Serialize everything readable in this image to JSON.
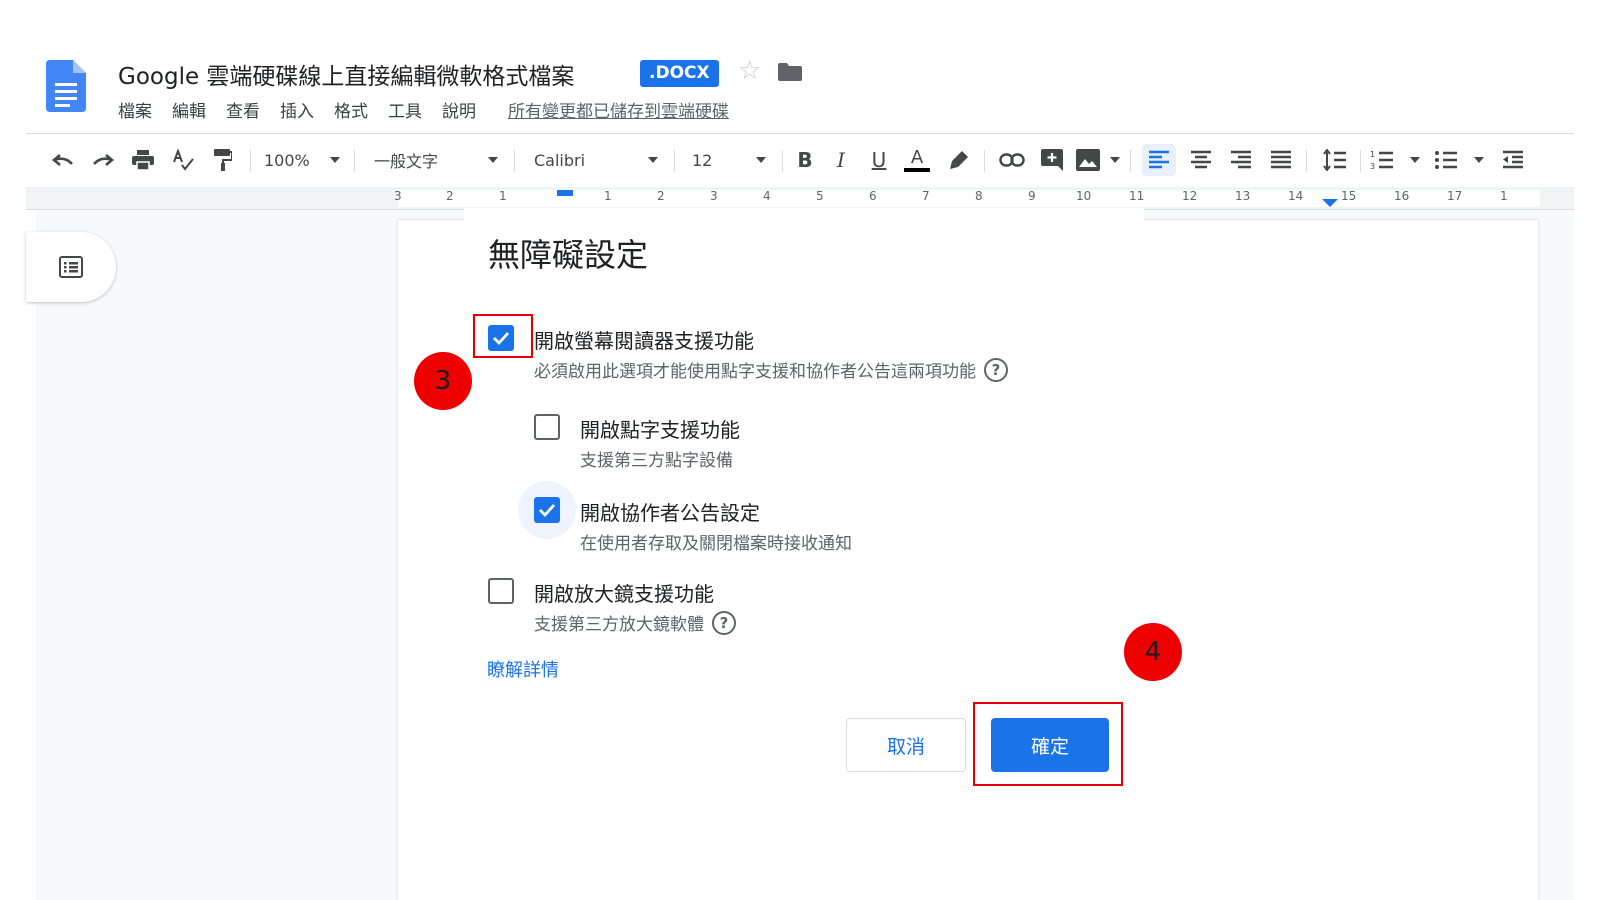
{
  "header": {
    "title": "Google 雲端硬碟線上直接編輯微軟格式檔案",
    "badge": ".DOCX",
    "star": "☆",
    "menu": [
      "檔案",
      "編輯",
      "查看",
      "插入",
      "格式",
      "工具",
      "說明"
    ],
    "save_status": "所有變更都已儲存到雲端硬碟"
  },
  "toolbar": {
    "zoom": "100%",
    "style": "一般文字",
    "font": "Calibri",
    "size": "12",
    "bold": "B",
    "italic": "I",
    "underline": "U",
    "text_color": "A"
  },
  "ruler": {
    "labels": [
      "3",
      "2",
      "1",
      "1",
      "2",
      "3",
      "4",
      "5",
      "6",
      "7",
      "8",
      "9",
      "10",
      "11",
      "12",
      "13",
      "14",
      "15",
      "16",
      "17",
      "1"
    ]
  },
  "dialog": {
    "title": "無障礙設定",
    "options": [
      {
        "label": "開啟螢幕閱讀器支援功能",
        "desc": "必須啟用此選項才能使用點字支援和協作者公告這兩項功能",
        "checked": true
      },
      {
        "label": "開啟點字支援功能",
        "desc": "支援第三方點字設備",
        "checked": false
      },
      {
        "label": "開啟協作者公告設定",
        "desc": "在使用者存取及關閉檔案時接收通知",
        "checked": true
      },
      {
        "label": "開啟放大鏡支援功能",
        "desc": "支援第三方放大鏡軟體",
        "checked": false
      }
    ],
    "help_glyph": "?",
    "learn_more": "瞭解詳情",
    "cancel": "取消",
    "ok": "確定"
  },
  "annotations": {
    "step3": "3",
    "step4": "4"
  },
  "colors": {
    "accent": "#1a73e8",
    "annotation_red": "#ee0000"
  }
}
